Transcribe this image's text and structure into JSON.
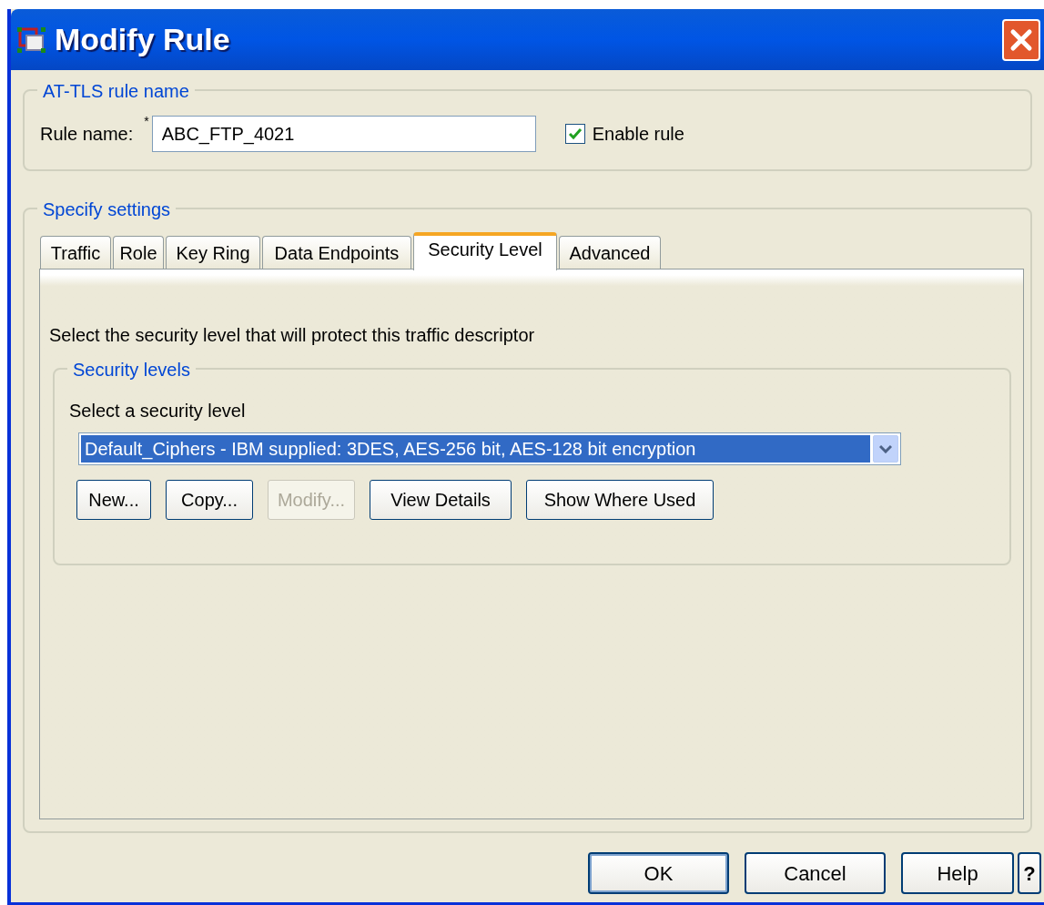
{
  "window": {
    "title": "Modify Rule"
  },
  "rule_name_group": {
    "legend": "AT-TLS rule name",
    "label": "Rule name:",
    "required_mark": "*",
    "value": "ABC_FTP_4021",
    "enable_rule": {
      "label": "Enable rule",
      "checked": true
    }
  },
  "settings_group": {
    "legend": "Specify settings"
  },
  "tabs": [
    {
      "label": "Traffic",
      "selected": false
    },
    {
      "label": "Role",
      "selected": false
    },
    {
      "label": "Key Ring",
      "selected": false
    },
    {
      "label": "Data Endpoints",
      "selected": false
    },
    {
      "label": "Security Level",
      "selected": true
    },
    {
      "label": "Advanced",
      "selected": false
    }
  ],
  "panel": {
    "description": "Select the security level that will protect this traffic descriptor",
    "security_levels": {
      "legend": "Security levels",
      "label": "Select a security level",
      "value": "Default_Ciphers - IBM supplied: 3DES, AES-256 bit, AES-128 bit encryption",
      "buttons": [
        {
          "label": "New...",
          "disabled": false
        },
        {
          "label": "Copy...",
          "disabled": false
        },
        {
          "label": "Modify...",
          "disabled": true
        },
        {
          "label": "View Details",
          "disabled": false
        },
        {
          "label": "Show Where Used",
          "disabled": false
        }
      ]
    }
  },
  "footer_buttons": [
    {
      "label": "OK",
      "default": true
    },
    {
      "label": "Cancel",
      "default": false
    },
    {
      "label": "Help",
      "default": false
    },
    {
      "label": "?",
      "default": false
    }
  ]
}
